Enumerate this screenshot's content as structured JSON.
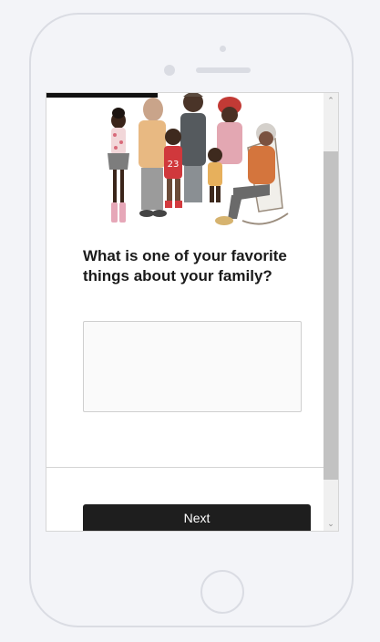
{
  "survey": {
    "progress_fraction": 0.4,
    "illustration": {
      "icon": "family-illustration",
      "jersey_number": "23"
    },
    "question": "What is one of your favorite things about your family?",
    "answer": {
      "value": "",
      "placeholder": ""
    },
    "next_label": "Next"
  },
  "scrollbar": {
    "up_icon": "chevron-up-icon",
    "down_icon": "chevron-down-icon",
    "up_glyph": "⌃",
    "down_glyph": "⌄"
  },
  "colors": {
    "button": "#1e1e1e",
    "progress": "#111111",
    "page_background": "#f3f4f8"
  }
}
